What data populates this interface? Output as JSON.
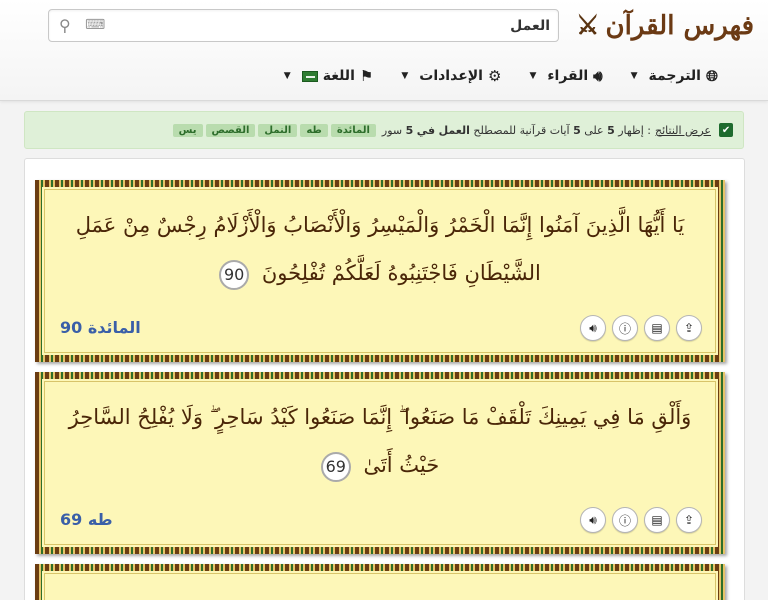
{
  "header": {
    "brand_title": "فهرس القرآن",
    "search": {
      "value": "العمل",
      "placeholder": ""
    },
    "nav": [
      {
        "label": "الترجمة"
      },
      {
        "label": "القراء"
      },
      {
        "label": "الإعدادات"
      },
      {
        "label": "اللغة"
      }
    ]
  },
  "banner": {
    "link_text": "عرض النتائج",
    "text_before_count": ": إظهار",
    "shown": "5",
    "text_on": "على",
    "total": "5",
    "text_middle": "آيات قرآنية للمصطلح",
    "term": "العمل",
    "text_in": "في",
    "surah_count": "5",
    "text_surahs": "سور",
    "chips": [
      "المائدة",
      "طه",
      "النمل",
      "القصص",
      "يس"
    ]
  },
  "results": [
    {
      "text": "يَا أَيُّهَا الَّذِينَ آمَنُوا إِنَّمَا الْخَمْرُ وَالْمَيْسِرُ وَالْأَنْصَابُ وَالْأَزْلَامُ رِجْسٌ مِنْ عَمَلِ الشَّيْطَانِ فَاجْتَنِبُوهُ لَعَلَّكُمْ تُفْلِحُونَ",
      "ayah_number": "90",
      "reference": "المائدة 90"
    },
    {
      "text": "وَأَلْقِ مَا فِي يَمِينِكَ تَلْقَفْ مَا صَنَعُوا ۖ إِنَّمَا صَنَعُوا كَيْدُ سَاحِرٍ ۖ وَلَا يُفْلِحُ السَّاحِرُ حَيْثُ أَتَىٰ",
      "ayah_number": "69",
      "reference": "طه 69"
    }
  ],
  "colors": {
    "brand": "#6b3a14",
    "banner_bg": "#dff0d8",
    "verse_bg": "#fdf7b8",
    "reference": "#3a5fa8"
  }
}
